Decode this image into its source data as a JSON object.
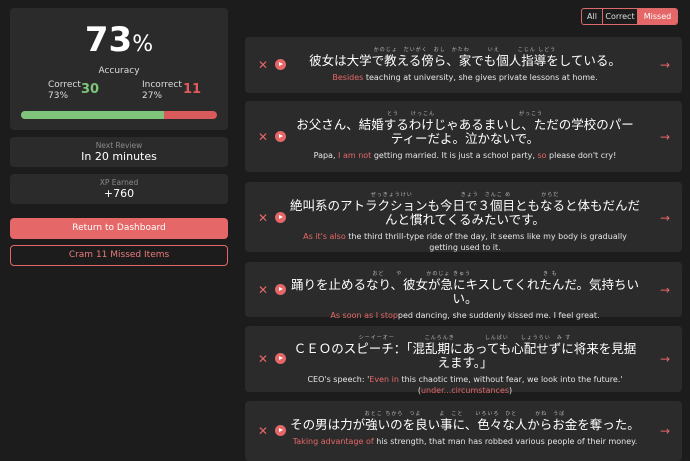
{
  "stats": {
    "accuracy_value": "73",
    "accuracy_suffix": "%",
    "accuracy_label": "Accuracy",
    "correct_label": "Correct",
    "correct_pct": "73%",
    "correct_count": "30",
    "incorrect_label": "Incorrect",
    "incorrect_pct": "27%",
    "incorrect_count": "11",
    "correct_ratio": 0.73
  },
  "next_review": {
    "label": "Next Review",
    "value": "In 20 minutes"
  },
  "xp": {
    "label": "XP Earned",
    "value": "+760"
  },
  "buttons": {
    "dashboard": "Return to Dashboard",
    "cram": "Cram 11 Missed Items"
  },
  "filters": {
    "all": "All",
    "correct": "Correct",
    "missed": "Missed",
    "active": "Missed"
  },
  "colors": {
    "accent": "#e56767",
    "correct": "#7ec47a",
    "card": "#2b2b2b",
    "background": "#1c1c1c"
  },
  "icons": {
    "remove": "close-x-icon",
    "audio": "play-icon",
    "open": "arrow-right-icon"
  },
  "items": [
    {
      "furigana": "かのじょ　だいがく　おし　かたわ　　　いえ　　　こじん しどう",
      "jp": "彼女は大学で教える傍ら、家でも個人指導をしている。",
      "en_pre": "",
      "en_hl1": "Besides",
      "en_mid": " teaching at university, she gives private lessons at home.",
      "en_hl2": "",
      "en_post": ""
    },
    {
      "furigana": "とう　　けっこん　　　　　　　　　　　　　　がっこう",
      "jp": "お父さん、結婚するわけじゃあるまいし、ただの学校のパーティーだよ。泣かないで。",
      "en_pre": "Papa, ",
      "en_hl1": "I am not",
      "en_mid": " getting married. It is just a school party, ",
      "en_hl2": "so",
      "en_post": " please don't cry!"
    },
    {
      "furigana": "ぜっきょうけい　　　　　　　　きょう　さんこ め　　　　　からだ",
      "jp": "絶叫系のアトラクションも今日で３個目ともなると体もだんだんと慣れてくるみたいです。",
      "en_pre": "",
      "en_hl1": "As it's also",
      "en_mid": " the third thrill-type ride of the day, it seems like my body is gradually getting used to it.",
      "en_hl2": "",
      "en_post": ""
    },
    {
      "furigana": "おど　　や　　　　かのじょ きゅう　　　　　　　　　　　　き も",
      "jp": "踊りを止めるなり、彼女が急にキスしてくれたんだ。気持ちいい。",
      "en_pre": "",
      "en_hl1": "As soon as I stop",
      "en_mid": "ped dancing, she suddenly kissed me. I feel great.",
      "en_hl2": "",
      "en_post": ""
    },
    {
      "furigana": "シーイーオー　　　　　こんらんき　　　　　しんぱい　　しょうらい　み す",
      "jp": "ＣＥＯのスピーチ：「混乱期にあっても心配せずに将来を見据えます。」",
      "en_pre": "CEO's speech: '",
      "en_hl1": "Even in",
      "en_mid": " this chaotic time, without fear, we look into the future.' (",
      "en_hl2": "under...circumstances",
      "en_post": ")"
    },
    {
      "furigana": "おとこ ちから　つよ　　　よ　こと　　いろいろ　ひと　　　かね　うば",
      "jp": "その男は力が強いのを良い事に、色々な人からお金を奪った。",
      "en_pre": "",
      "en_hl1": "Taking advantage of",
      "en_mid": " his strength, that man has robbed various people of their money.",
      "en_hl2": "",
      "en_post": ""
    }
  ]
}
